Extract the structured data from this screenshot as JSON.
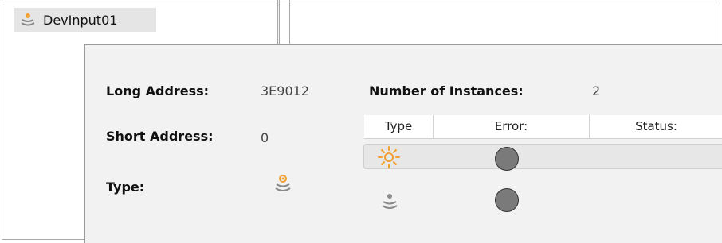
{
  "tree": {
    "item_label": "DevInput01",
    "item_icon": "sensor-icon"
  },
  "details": {
    "long_address_label": "Long Address:",
    "long_address_value": "3E9012",
    "short_address_label": "Short Address:",
    "short_address_value": "0",
    "type_label": "Type:",
    "type_icon": "sensor-icon",
    "instances_label": "Number of Instances:",
    "instances_value": "2"
  },
  "instances_table": {
    "columns": [
      "Type",
      "Error:",
      "Status:"
    ],
    "rows": [
      {
        "type_icon": "light-sensor-icon",
        "error_indicator": "grey",
        "selected": true
      },
      {
        "type_icon": "sensor-icon",
        "error_indicator": "grey",
        "selected": false
      }
    ]
  },
  "colors": {
    "indicator": "#7a7a7a",
    "sensor_orange": "#f0a030",
    "sensor_grey": "#808080"
  }
}
